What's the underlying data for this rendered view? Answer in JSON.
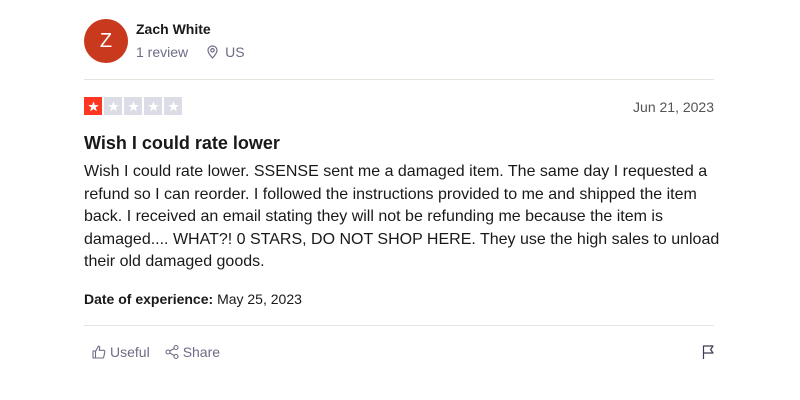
{
  "reviewer": {
    "initial": "Z",
    "name": "Zach White",
    "review_count": "1 review",
    "location": "US",
    "avatar_color": "#c8391e"
  },
  "review": {
    "rating": 1,
    "max_rating": 5,
    "date": "Jun 21, 2023",
    "title": "Wish I could rate lower",
    "body": "Wish I could rate lower. SSENSE sent me a damaged item. The same day I requested a refund so I can reorder. I followed the instructions provided to me and shipped the item back. I received an email stating they will not be refunding me because the item is damaged.... WHAT?! 0 STARS, DO NOT SHOP HERE. They use the high sales to unload their old damaged goods.",
    "experience_label": "Date of experience:",
    "experience_date": "May 25, 2023"
  },
  "actions": {
    "useful_label": "Useful",
    "share_label": "Share",
    "useful_icon": "thumbs-up-icon",
    "share_icon": "share-icon",
    "flag_icon": "flag-icon"
  },
  "colors": {
    "star_filled": "#ff3722",
    "star_empty": "#dcdce6",
    "muted_text": "#6c6c85"
  }
}
